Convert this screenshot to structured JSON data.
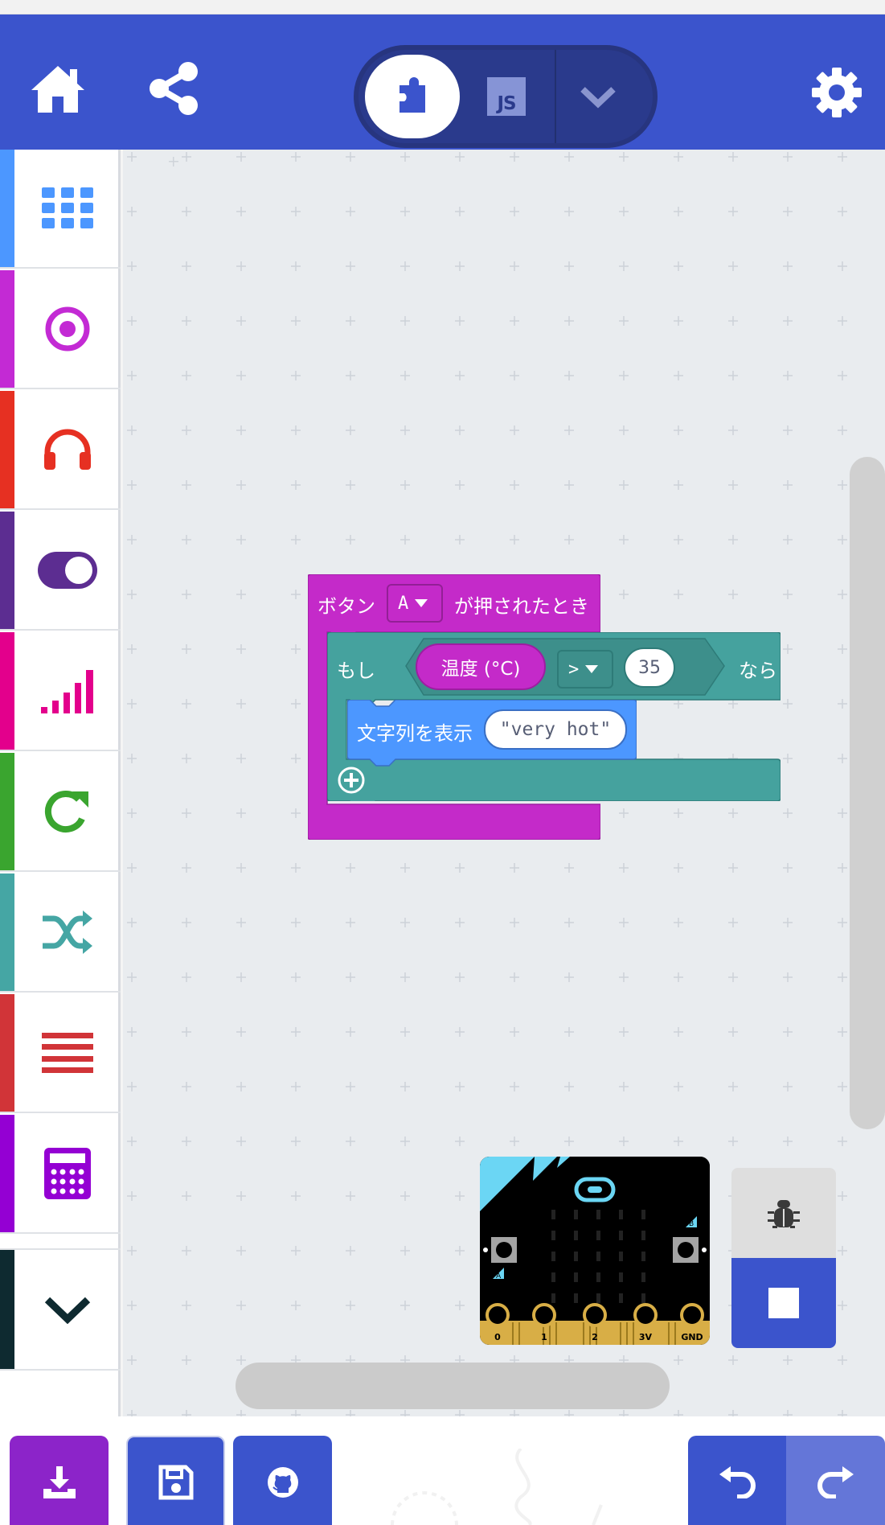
{
  "header": {
    "home_icon": "home-icon",
    "share_icon": "share-icon",
    "blocks_mode_icon": "puzzle-icon",
    "js_mode_label": "JS",
    "mode_dropdown_icon": "chevron-down-icon",
    "settings_icon": "gear-icon"
  },
  "toolbox": {
    "categories": [
      {
        "icon": "grid-icon",
        "color": "#4c97ff"
      },
      {
        "icon": "target-icon",
        "color": "#c32ad4"
      },
      {
        "icon": "headphones-icon",
        "color": "#e63022"
      },
      {
        "icon": "toggle-icon",
        "color": "#5c2d91"
      },
      {
        "icon": "signal-icon",
        "color": "#e3008c"
      },
      {
        "icon": "loop-icon",
        "color": "#3aa52f"
      },
      {
        "icon": "shuffle-icon",
        "color": "#45a6a4"
      },
      {
        "icon": "list-icon",
        "color": "#d13438"
      },
      {
        "icon": "calculator-icon",
        "color": "#9400d3"
      },
      {
        "icon": "chevron-down-icon",
        "color": "#0e2a30"
      }
    ]
  },
  "blocks": {
    "event": {
      "label_before": "ボタン",
      "button_value": "A",
      "label_after": "が押されたとき",
      "color": "#c42ac9"
    },
    "if_block": {
      "label_if": "もし",
      "label_then": "なら",
      "color": "#45a29e"
    },
    "condition": {
      "sensor_label": "温度 (°C)",
      "operator": ">",
      "value": "35"
    },
    "show_string": {
      "label": "文字列を表示",
      "value": "\"very hot\"",
      "color": "#4c97ff"
    }
  },
  "simulator": {
    "pin_labels": [
      "0",
      "1",
      "2",
      "3V",
      "GND"
    ],
    "button_a": "A",
    "button_b": "B"
  },
  "bottom_bar": {
    "download_icon": "download-icon",
    "save_icon": "save-icon",
    "github_icon": "github-icon",
    "undo_icon": "undo-icon",
    "redo_icon": "redo-icon"
  },
  "sim_controls": {
    "debug_icon": "bug-icon",
    "stop_icon": "stop-icon"
  }
}
